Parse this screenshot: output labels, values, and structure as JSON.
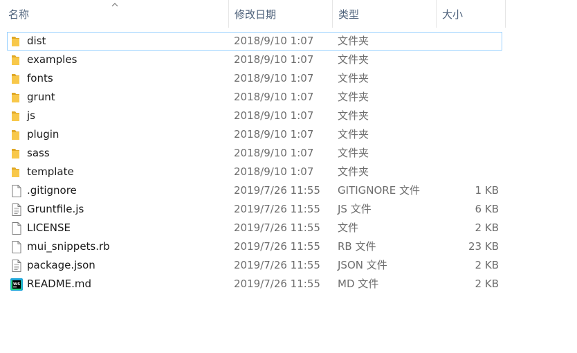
{
  "columns": {
    "name": "名称",
    "date": "修改日期",
    "type": "类型",
    "size": "大小"
  },
  "files": [
    {
      "name": "dist",
      "date": "2018/9/10 1:07",
      "type": "文件夹",
      "size": "",
      "icon": "folder-icon"
    },
    {
      "name": "examples",
      "date": "2018/9/10 1:07",
      "type": "文件夹",
      "size": "",
      "icon": "folder-icon"
    },
    {
      "name": "fonts",
      "date": "2018/9/10 1:07",
      "type": "文件夹",
      "size": "",
      "icon": "folder-icon"
    },
    {
      "name": "grunt",
      "date": "2018/9/10 1:07",
      "type": "文件夹",
      "size": "",
      "icon": "folder-icon"
    },
    {
      "name": "js",
      "date": "2018/9/10 1:07",
      "type": "文件夹",
      "size": "",
      "icon": "folder-icon"
    },
    {
      "name": "plugin",
      "date": "2018/9/10 1:07",
      "type": "文件夹",
      "size": "",
      "icon": "folder-icon"
    },
    {
      "name": "sass",
      "date": "2018/9/10 1:07",
      "type": "文件夹",
      "size": "",
      "icon": "folder-icon"
    },
    {
      "name": "template",
      "date": "2018/9/10 1:07",
      "type": "文件夹",
      "size": "",
      "icon": "folder-icon"
    },
    {
      "name": ".gitignore",
      "date": "2019/7/26 11:55",
      "type": "GITIGNORE 文件",
      "size": "1 KB",
      "icon": "file-icon"
    },
    {
      "name": "Gruntfile.js",
      "date": "2019/7/26 11:55",
      "type": "JS 文件",
      "size": "6 KB",
      "icon": "text-file-icon"
    },
    {
      "name": "LICENSE",
      "date": "2019/7/26 11:55",
      "type": "文件",
      "size": "2 KB",
      "icon": "file-icon"
    },
    {
      "name": "mui_snippets.rb",
      "date": "2019/7/26 11:55",
      "type": "RB 文件",
      "size": "23 KB",
      "icon": "file-icon"
    },
    {
      "name": "package.json",
      "date": "2019/7/26 11:55",
      "type": "JSON 文件",
      "size": "2 KB",
      "icon": "text-file-icon"
    },
    {
      "name": "README.md",
      "date": "2019/7/26 11:55",
      "type": "MD 文件",
      "size": "2 KB",
      "icon": "webstorm-icon"
    }
  ],
  "selected_row": 0,
  "colors": {
    "folder": "#f8c84a",
    "folder_dark": "#e0a826",
    "selection_border": "#99d1ff",
    "header_text": "#4c607a",
    "meta_text": "#6d6d6d"
  }
}
